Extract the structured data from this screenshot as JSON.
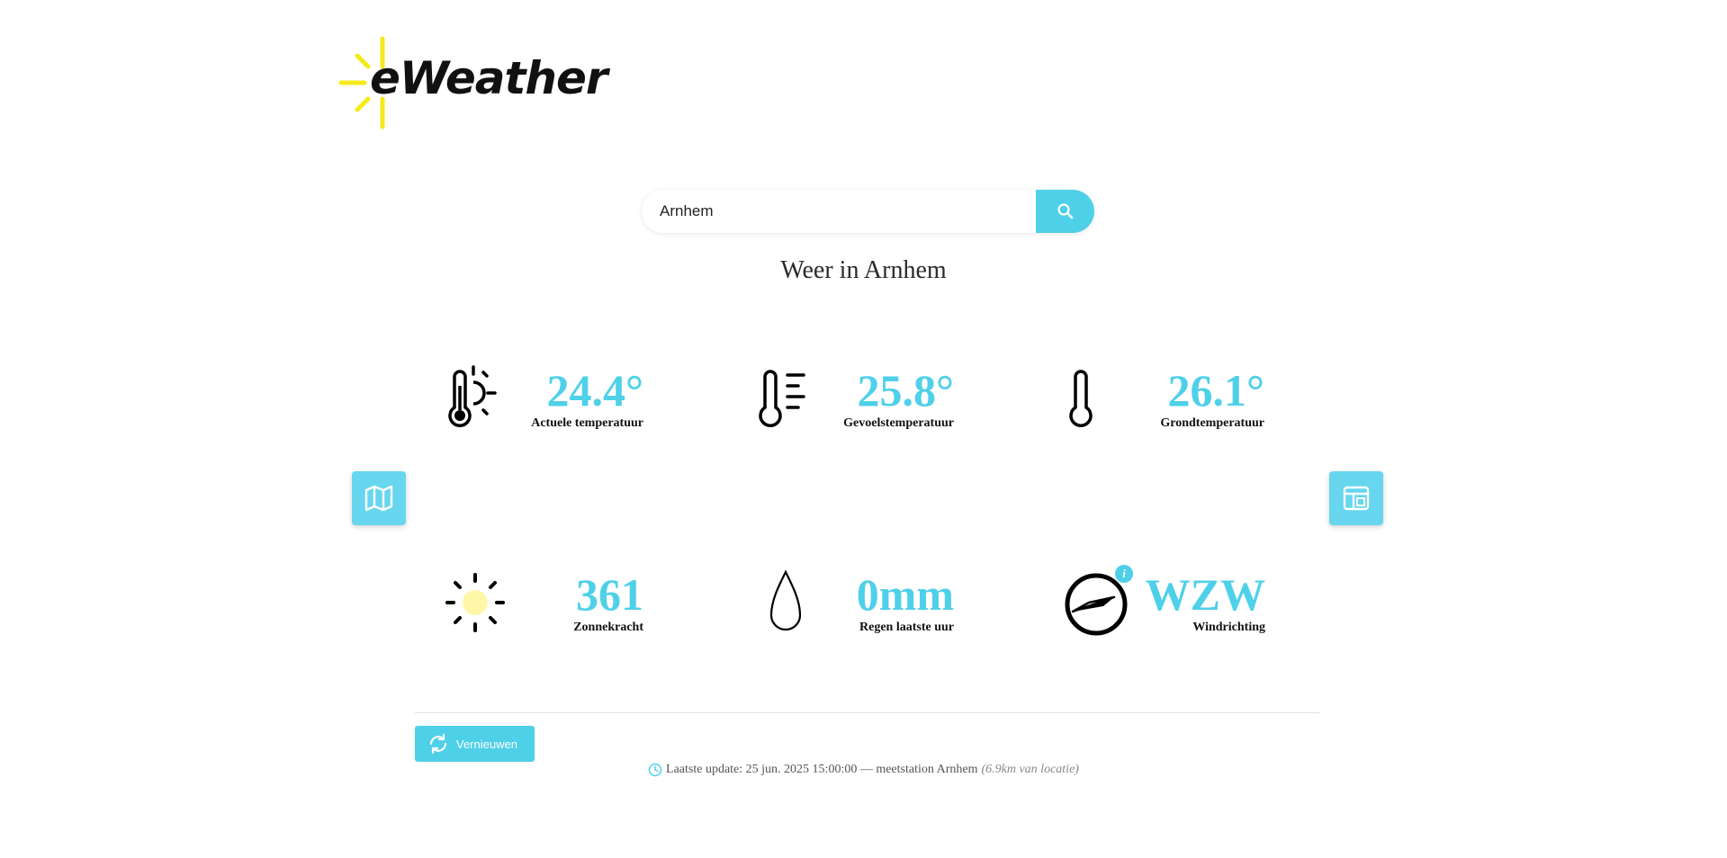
{
  "logo": {
    "text": "eWeather"
  },
  "search": {
    "value": "Arnhem",
    "placeholder": ""
  },
  "title": "Weer in Arnhem",
  "tiles": [
    {
      "value": "24.4°",
      "label": "Actuele temperatuur",
      "icon": "thermometer-sun-icon"
    },
    {
      "value": "25.8°",
      "label": "Gevoelstemperatuur",
      "icon": "thermometer-lines-icon"
    },
    {
      "value": "26.1°",
      "label": "Grondtemperatuur",
      "icon": "thermometer-icon"
    },
    {
      "value": "361",
      "label": "Zonnekracht",
      "icon": "sun-icon"
    },
    {
      "value": "0mm",
      "label": "Regen laatste uur",
      "icon": "raindrop-icon"
    },
    {
      "value": "WZW",
      "label": "Windrichting",
      "icon": "compass-icon"
    }
  ],
  "info_badge": "i",
  "side_buttons": {
    "left": "map-icon",
    "right": "layout-icon"
  },
  "refresh": {
    "label": "Vernieuwen"
  },
  "update": {
    "text": "Laatste update: 25 jun. 2025 15:00:00 — meetstation Arnhem",
    "distance": "(6.9km van locatie)"
  },
  "colors": {
    "accent": "#4fd0e9",
    "sun_yellow": "#f5ea1c",
    "sun_fill": "#fff7a8"
  }
}
